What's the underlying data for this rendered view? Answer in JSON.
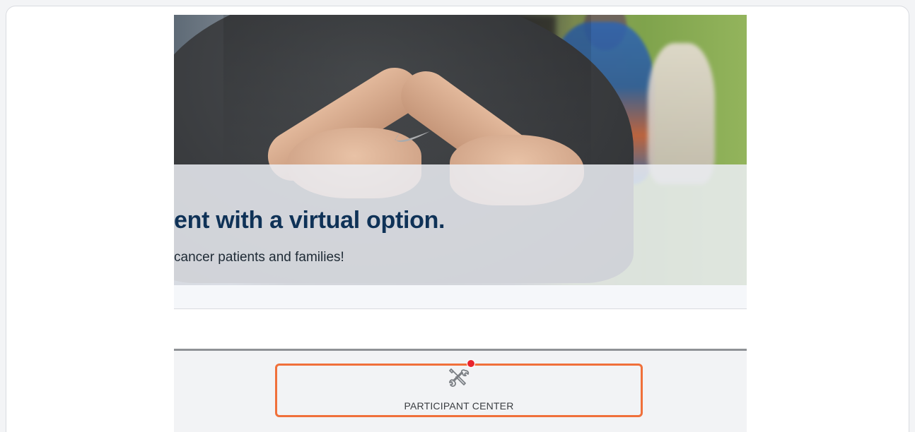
{
  "banner": {
    "headline": "ent with a virtual option.",
    "subtext": "cancer patients and families!"
  },
  "nav": {
    "participant_center": {
      "label": "PARTICIPANT CENTER",
      "icon": "tools-icon"
    }
  },
  "colors": {
    "headline": "#0f3257",
    "highlight": "#f0703a",
    "click_marker": "#e8242d"
  }
}
